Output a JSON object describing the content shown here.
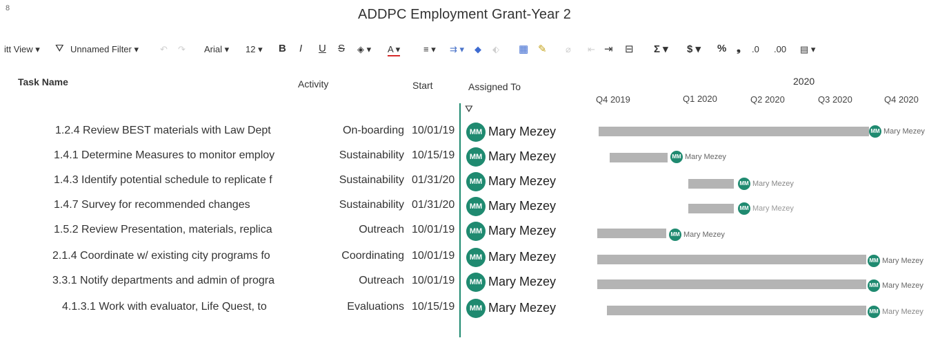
{
  "window": {
    "corner_glyph": "8",
    "title": "ADDPC Employment Grant-Year 2"
  },
  "toolbar": {
    "view_label": "itt View ▾",
    "filter_icon": "funnel-icon",
    "filter_label": "Unnamed Filter ▾",
    "undo_glyph": "↶",
    "redo_glyph": "↷",
    "font_name": "Arial ▾",
    "font_size": "12 ▾",
    "bold": "B",
    "italic": "I",
    "underline": "U",
    "strike": "S",
    "fill_color": "◈ ▾",
    "text_color": "A ▾",
    "align": "≡ ▾",
    "wrap": "⇉ ▾",
    "eraser": "◆",
    "paint": "⬖",
    "table_glyph": "▦",
    "highlight_glyph": "✎",
    "link_glyph": "⌀",
    "indent_glyph": "⇤",
    "outdent_glyph": "⇥",
    "gantt_glyph": "⊟",
    "sum": "Σ ▾",
    "currency": "$ ▾",
    "percent": "%",
    "comma": "❟",
    "dec_less": ".0",
    "dec_more": ".00",
    "format": "▤ ▾",
    "accent_color": "#1f8a70"
  },
  "grid": {
    "headers": {
      "task": "Task Name",
      "activity": "Activity",
      "start": "Start",
      "assigned": "Assigned To"
    },
    "timeline": {
      "year": "2020",
      "quarters": [
        "Q4 2019",
        "Q1 2020",
        "Q2 2020",
        "Q3 2020",
        "Q4 2020"
      ]
    },
    "rows": [
      {
        "task": "1.2.4 Review BEST materials with Law Dept",
        "activity": "On-boarding",
        "start": "10/01/19",
        "initials": "MM",
        "assigned": "Mary Mezey",
        "bar_label": "Mary Mezey"
      },
      {
        "task": "1.4.1 Determine Measures to monitor employ",
        "activity": "Sustainability",
        "start": "10/15/19",
        "initials": "MM",
        "assigned": "Mary Mezey",
        "bar_label": "Mary Mezey"
      },
      {
        "task": "1.4.3 Identify potential schedule to replicate f",
        "activity": "Sustainability",
        "start": "01/31/20",
        "initials": "MM",
        "assigned": "Mary Mezey",
        "bar_label": "Mary Mezey"
      },
      {
        "task": "1.4.7 Survey for recommended changes",
        "activity": "Sustainability",
        "start": "01/31/20",
        "initials": "MM",
        "assigned": "Mary Mezey",
        "bar_label": "Mary Mezey"
      },
      {
        "task": "1.5.2 Review Presentation, materials, replica",
        "activity": "Outreach",
        "start": "10/01/19",
        "initials": "MM",
        "assigned": "Mary Mezey",
        "bar_label": "Mary Mezey"
      },
      {
        "task": "2.1.4 Coordinate w/ existing city programs fo",
        "activity": "Coordinating",
        "start": "10/01/19",
        "initials": "MM",
        "assigned": "Mary Mezey",
        "bar_label": "Mary Mezey"
      },
      {
        "task": "3.3.1 Notify departments and admin of progra",
        "activity": "Outreach",
        "start": "10/01/19",
        "initials": "MM",
        "assigned": "Mary Mezey",
        "bar_label": "Mary Mezey"
      },
      {
        "task": "4.1.3.1 Work with evaluator, Life Quest, to",
        "activity": "Evaluations",
        "start": "10/15/19",
        "initials": "MM",
        "assigned": "Mary Mezey",
        "bar_label": "Mary Mezey"
      }
    ]
  }
}
